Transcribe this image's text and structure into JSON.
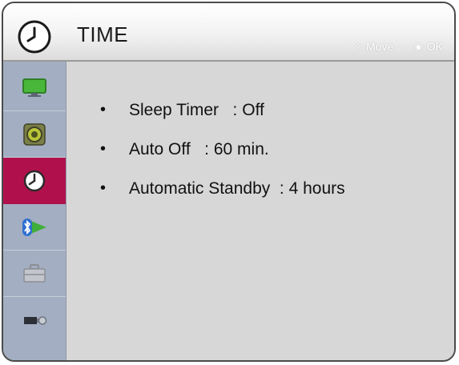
{
  "header": {
    "title": "TIME",
    "icon": "clock-icon",
    "hints": [
      {
        "icon": "move-arrows-icon",
        "glyph": "✧",
        "label": "Move"
      },
      {
        "icon": "ok-button-icon",
        "glyph": "◉",
        "label": "OK"
      }
    ]
  },
  "sidebar": {
    "items": [
      {
        "name": "picture",
        "icon": "monitor-icon",
        "active": false
      },
      {
        "name": "audio",
        "icon": "speaker-icon",
        "active": false
      },
      {
        "name": "time",
        "icon": "clock-icon",
        "active": true
      },
      {
        "name": "network",
        "icon": "bluetooth-network-icon",
        "active": false
      },
      {
        "name": "option",
        "icon": "toolbox-icon",
        "active": false
      },
      {
        "name": "input",
        "icon": "usb-input-icon",
        "active": false
      }
    ]
  },
  "menu": {
    "items": [
      {
        "label": "Sleep Timer",
        "separator": "   : ",
        "value": "Off"
      },
      {
        "label": "Auto Off",
        "separator": "   : ",
        "value": "60 min."
      },
      {
        "label": "Automatic Standby",
        "separator": "  : ",
        "value": "4 hours"
      }
    ]
  },
  "colors": {
    "active_tab": "#b0114c",
    "sidebar_bg": "#a3aec2",
    "panel_bg": "#d7d7d7"
  }
}
